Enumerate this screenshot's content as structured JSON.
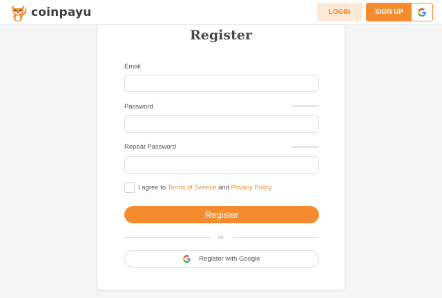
{
  "brand": {
    "name": "coinpayu",
    "logo_icon": "fox-icon",
    "accent": "#f58b2f"
  },
  "header": {
    "login_label": "LOGIN",
    "signup_label": "SIGN UP",
    "google_icon": "google-icon"
  },
  "form": {
    "title": "Register",
    "email_label": "Email",
    "email_value": "",
    "password_label": "Password",
    "password_value": "",
    "repeat_password_label": "Repeat Password",
    "repeat_password_value": "",
    "agree_prefix": "I agree to",
    "terms_label": "Terms of Service",
    "agree_and": "and",
    "privacy_label": "Privacy Policy",
    "agree_checked": false,
    "register_label": "Register",
    "or_label": "or",
    "google_register_label": "Register with Google"
  }
}
